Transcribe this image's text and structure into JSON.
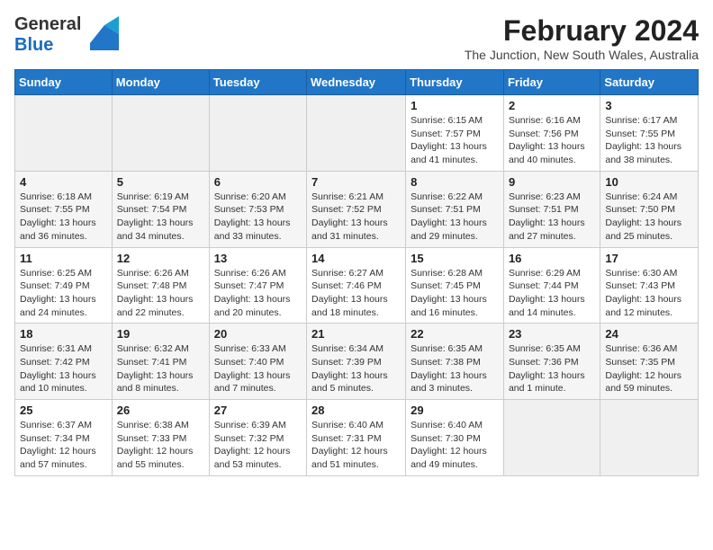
{
  "header": {
    "logo_line1": "General",
    "logo_line2": "Blue",
    "month_title": "February 2024",
    "subtitle": "The Junction, New South Wales, Australia"
  },
  "weekdays": [
    "Sunday",
    "Monday",
    "Tuesday",
    "Wednesday",
    "Thursday",
    "Friday",
    "Saturday"
  ],
  "weeks": [
    [
      {
        "day": "",
        "info": ""
      },
      {
        "day": "",
        "info": ""
      },
      {
        "day": "",
        "info": ""
      },
      {
        "day": "",
        "info": ""
      },
      {
        "day": "1",
        "info": "Sunrise: 6:15 AM\nSunset: 7:57 PM\nDaylight: 13 hours and 41 minutes."
      },
      {
        "day": "2",
        "info": "Sunrise: 6:16 AM\nSunset: 7:56 PM\nDaylight: 13 hours and 40 minutes."
      },
      {
        "day": "3",
        "info": "Sunrise: 6:17 AM\nSunset: 7:55 PM\nDaylight: 13 hours and 38 minutes."
      }
    ],
    [
      {
        "day": "4",
        "info": "Sunrise: 6:18 AM\nSunset: 7:55 PM\nDaylight: 13 hours and 36 minutes."
      },
      {
        "day": "5",
        "info": "Sunrise: 6:19 AM\nSunset: 7:54 PM\nDaylight: 13 hours and 34 minutes."
      },
      {
        "day": "6",
        "info": "Sunrise: 6:20 AM\nSunset: 7:53 PM\nDaylight: 13 hours and 33 minutes."
      },
      {
        "day": "7",
        "info": "Sunrise: 6:21 AM\nSunset: 7:52 PM\nDaylight: 13 hours and 31 minutes."
      },
      {
        "day": "8",
        "info": "Sunrise: 6:22 AM\nSunset: 7:51 PM\nDaylight: 13 hours and 29 minutes."
      },
      {
        "day": "9",
        "info": "Sunrise: 6:23 AM\nSunset: 7:51 PM\nDaylight: 13 hours and 27 minutes."
      },
      {
        "day": "10",
        "info": "Sunrise: 6:24 AM\nSunset: 7:50 PM\nDaylight: 13 hours and 25 minutes."
      }
    ],
    [
      {
        "day": "11",
        "info": "Sunrise: 6:25 AM\nSunset: 7:49 PM\nDaylight: 13 hours and 24 minutes."
      },
      {
        "day": "12",
        "info": "Sunrise: 6:26 AM\nSunset: 7:48 PM\nDaylight: 13 hours and 22 minutes."
      },
      {
        "day": "13",
        "info": "Sunrise: 6:26 AM\nSunset: 7:47 PM\nDaylight: 13 hours and 20 minutes."
      },
      {
        "day": "14",
        "info": "Sunrise: 6:27 AM\nSunset: 7:46 PM\nDaylight: 13 hours and 18 minutes."
      },
      {
        "day": "15",
        "info": "Sunrise: 6:28 AM\nSunset: 7:45 PM\nDaylight: 13 hours and 16 minutes."
      },
      {
        "day": "16",
        "info": "Sunrise: 6:29 AM\nSunset: 7:44 PM\nDaylight: 13 hours and 14 minutes."
      },
      {
        "day": "17",
        "info": "Sunrise: 6:30 AM\nSunset: 7:43 PM\nDaylight: 13 hours and 12 minutes."
      }
    ],
    [
      {
        "day": "18",
        "info": "Sunrise: 6:31 AM\nSunset: 7:42 PM\nDaylight: 13 hours and 10 minutes."
      },
      {
        "day": "19",
        "info": "Sunrise: 6:32 AM\nSunset: 7:41 PM\nDaylight: 13 hours and 8 minutes."
      },
      {
        "day": "20",
        "info": "Sunrise: 6:33 AM\nSunset: 7:40 PM\nDaylight: 13 hours and 7 minutes."
      },
      {
        "day": "21",
        "info": "Sunrise: 6:34 AM\nSunset: 7:39 PM\nDaylight: 13 hours and 5 minutes."
      },
      {
        "day": "22",
        "info": "Sunrise: 6:35 AM\nSunset: 7:38 PM\nDaylight: 13 hours and 3 minutes."
      },
      {
        "day": "23",
        "info": "Sunrise: 6:35 AM\nSunset: 7:36 PM\nDaylight: 13 hours and 1 minute."
      },
      {
        "day": "24",
        "info": "Sunrise: 6:36 AM\nSunset: 7:35 PM\nDaylight: 12 hours and 59 minutes."
      }
    ],
    [
      {
        "day": "25",
        "info": "Sunrise: 6:37 AM\nSunset: 7:34 PM\nDaylight: 12 hours and 57 minutes."
      },
      {
        "day": "26",
        "info": "Sunrise: 6:38 AM\nSunset: 7:33 PM\nDaylight: 12 hours and 55 minutes."
      },
      {
        "day": "27",
        "info": "Sunrise: 6:39 AM\nSunset: 7:32 PM\nDaylight: 12 hours and 53 minutes."
      },
      {
        "day": "28",
        "info": "Sunrise: 6:40 AM\nSunset: 7:31 PM\nDaylight: 12 hours and 51 minutes."
      },
      {
        "day": "29",
        "info": "Sunrise: 6:40 AM\nSunset: 7:30 PM\nDaylight: 12 hours and 49 minutes."
      },
      {
        "day": "",
        "info": ""
      },
      {
        "day": "",
        "info": ""
      }
    ]
  ]
}
